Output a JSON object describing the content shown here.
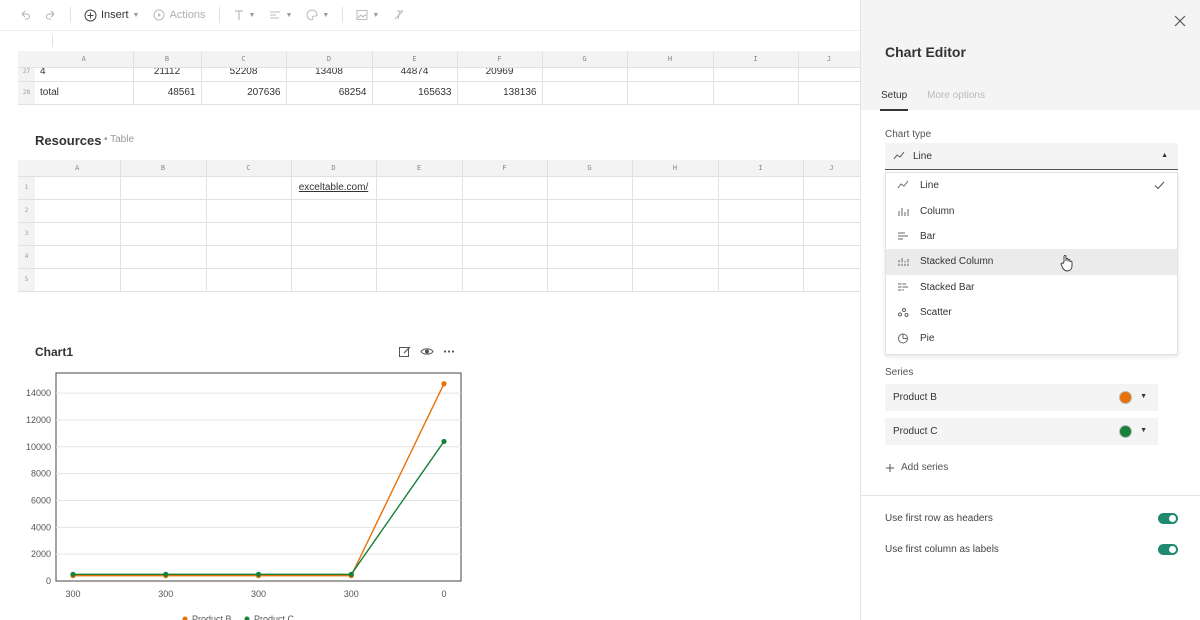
{
  "toolbar": {
    "insert_label": "Insert",
    "actions_label": "Actions"
  },
  "top_table": {
    "columns": [
      "A",
      "B",
      "C",
      "D",
      "E",
      "F",
      "G",
      "H",
      "I",
      "J"
    ],
    "rows": [
      {
        "num": "27",
        "cells": [
          "4",
          "21112",
          "52208",
          "13408",
          "44874",
          "20969",
          "",
          "",
          "",
          ""
        ]
      },
      {
        "num": "28",
        "cells": [
          "total",
          "48561",
          "207636",
          "68254",
          "165633",
          "138136",
          "",
          "",
          "",
          ""
        ]
      }
    ]
  },
  "resources": {
    "title": "Resources",
    "tag": "Table",
    "columns": [
      "A",
      "B",
      "C",
      "D",
      "E",
      "F",
      "G",
      "H",
      "I",
      "J"
    ],
    "rows": [
      {
        "num": "1",
        "cells": [
          "",
          "",
          "",
          "exceltable.com/",
          "",
          "",
          "",
          "",
          "",
          ""
        ]
      },
      {
        "num": "2",
        "cells": [
          "",
          "",
          "",
          "",
          "",
          "",
          "",
          "",
          "",
          ""
        ]
      },
      {
        "num": "3",
        "cells": [
          "",
          "",
          "",
          "",
          "",
          "",
          "",
          "",
          "",
          ""
        ]
      },
      {
        "num": "4",
        "cells": [
          "",
          "",
          "",
          "",
          "",
          "",
          "",
          "",
          "",
          ""
        ]
      },
      {
        "num": "5",
        "cells": [
          "",
          "",
          "",
          "",
          "",
          "",
          "",
          "",
          "",
          ""
        ]
      }
    ]
  },
  "chart_card": {
    "title": "Chart1"
  },
  "chart_data": {
    "type": "line",
    "categories": [
      "300",
      "300",
      "300",
      "300",
      "0"
    ],
    "series": [
      {
        "name": "Product B",
        "values": [
          400,
          400,
          400,
          400,
          14700
        ],
        "color": "#e8710a"
      },
      {
        "name": "Product C",
        "values": [
          500,
          500,
          500,
          500,
          10400
        ],
        "color": "#188038"
      }
    ],
    "ylim": [
      0,
      15500
    ],
    "yticks": [
      0,
      2000,
      4000,
      6000,
      8000,
      10000,
      12000,
      14000
    ],
    "ytick_labels": [
      "0",
      "2000",
      "4000",
      "6000",
      "8000",
      "10000",
      "12000",
      "14000"
    ],
    "grid": true,
    "legend": "bottom"
  },
  "panel": {
    "title": "Chart Editor",
    "tabs": [
      {
        "label": "Setup",
        "active": true
      },
      {
        "label": "More options",
        "active": false
      }
    ],
    "chart_type_label": "Chart type",
    "chart_type_selected": "Line",
    "options": [
      {
        "label": "Line",
        "icon": "line-chart-icon",
        "selected": true
      },
      {
        "label": "Column",
        "icon": "column-chart-icon"
      },
      {
        "label": "Bar",
        "icon": "bar-chart-icon"
      },
      {
        "label": "Stacked Column",
        "icon": "stacked-column-icon",
        "hover": true
      },
      {
        "label": "Stacked Bar",
        "icon": "stacked-bar-icon"
      },
      {
        "label": "Scatter",
        "icon": "scatter-chart-icon"
      },
      {
        "label": "Pie",
        "icon": "pie-chart-icon"
      }
    ],
    "series_label": "Series",
    "series": [
      {
        "name": "Product B",
        "color": "#e8710a"
      },
      {
        "name": "Product C",
        "color": "#188038"
      }
    ],
    "add_series_label": "Add series",
    "toggles": [
      {
        "label": "Use first row as headers",
        "on": true
      },
      {
        "label": "Use first column as labels",
        "on": true
      }
    ]
  }
}
